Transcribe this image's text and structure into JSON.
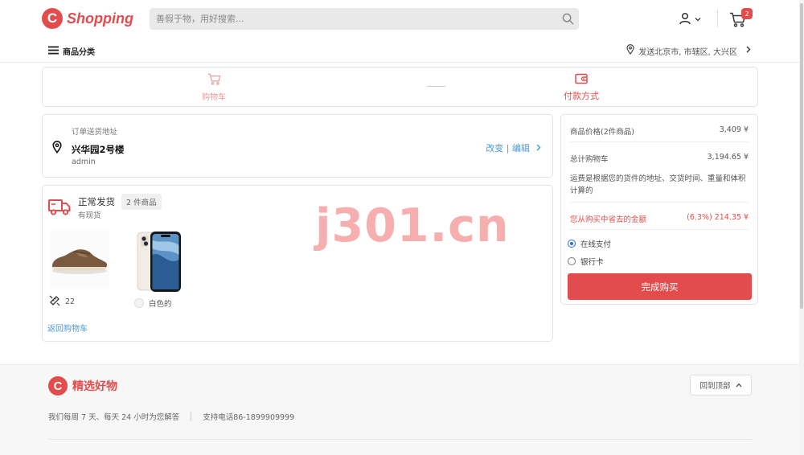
{
  "header": {
    "logo_text": "Shopping",
    "logo_letter": "C",
    "search_placeholder": "善假于物，用好搜索...",
    "cart_count": "2",
    "category_label": "商品分类",
    "ship_to": "发送北京市, 市辖区, 大兴区"
  },
  "steps": {
    "cart_label": "购物车",
    "payment_label": "付款方式"
  },
  "address": {
    "label": "订单送货地址",
    "name": "兴华园2号楼",
    "user": "admin",
    "edit_link": "改变 | 编辑"
  },
  "delivery": {
    "title": "正常发货",
    "status": "有现货",
    "count": "2 件商品",
    "items": [
      {
        "name": "shoe",
        "attribute": "22"
      },
      {
        "name": "phone",
        "attribute": "白色的"
      }
    ],
    "back_link": "返回购物车"
  },
  "summary": {
    "price_label": "商品价格(2件商品)",
    "price_value": "3,409 ¥",
    "total_label": "总计购物车",
    "total_value": "3,194.65 ¥",
    "note": "运费是根据您的货件的地址、交货时间、重量和体积计算的",
    "saving_label": "您从购买中省去的金额",
    "saving_value": "(6.3%) 214.35 ¥",
    "pay_options": [
      "在线支付",
      "银行卡"
    ],
    "selected_pay": "在线支付",
    "buy_button": "完成购买"
  },
  "watermark": "j301.cn",
  "footer": {
    "brand": "精选好物",
    "back_to_top": "回到顶部",
    "hours": "我们每周 7 天、每天 24 小时为您解答",
    "phone": "支持电话86-1899909999"
  },
  "colors": {
    "brand": "#e34c4c",
    "link": "#4a9ad6",
    "radio_selected": "#2f6bd8"
  }
}
